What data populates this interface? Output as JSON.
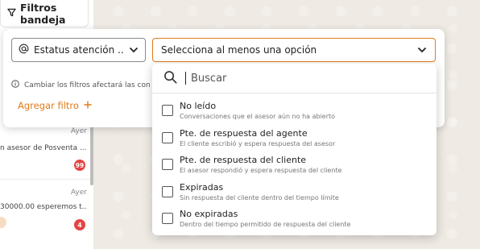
{
  "filter_tab": {
    "label": "Filtros bandeja",
    "icon": "filter-icon"
  },
  "chat_list": [
    {
      "time": "Ayer",
      "snippet": "n asesor de Posventa ...",
      "badge": "99"
    },
    {
      "time": "Ayer",
      "snippet": "30000.00 esperemos t...",
      "badge": "4"
    }
  ],
  "filter_card": {
    "field_select": {
      "icon": "at-icon",
      "value": "Estatus atención ...",
      "chevron": "chevron-down-icon"
    },
    "value_select": {
      "placeholder": "Selecciona al menos una opción",
      "chevron": "chevron-down-icon"
    },
    "info_text": "Cambiar los filtros afectará las con",
    "add_filter_label": "Agregar filtro",
    "add_filter_icon": "plus-icon",
    "accent_color": "#e07b1a"
  },
  "dropdown": {
    "search_placeholder": "Buscar",
    "options": [
      {
        "label": "No leído",
        "description": "Conversaciones que el asesor aún no ha abierto",
        "checked": false
      },
      {
        "label": "Pte. de respuesta del agente",
        "description": "El cliente escribió y espera respuesta del asesor",
        "checked": false
      },
      {
        "label": "Pte. de respuesta del cliente",
        "description": "El asesor respondió y espera respuesta del cliente",
        "checked": false
      },
      {
        "label": "Expiradas",
        "description": "Sin respuesta del cliente dentro del tiempo límite",
        "checked": false
      },
      {
        "label": "No expiradas",
        "description": "Dentro del tiempo permitido de respuesta del cliente",
        "checked": false
      }
    ]
  }
}
